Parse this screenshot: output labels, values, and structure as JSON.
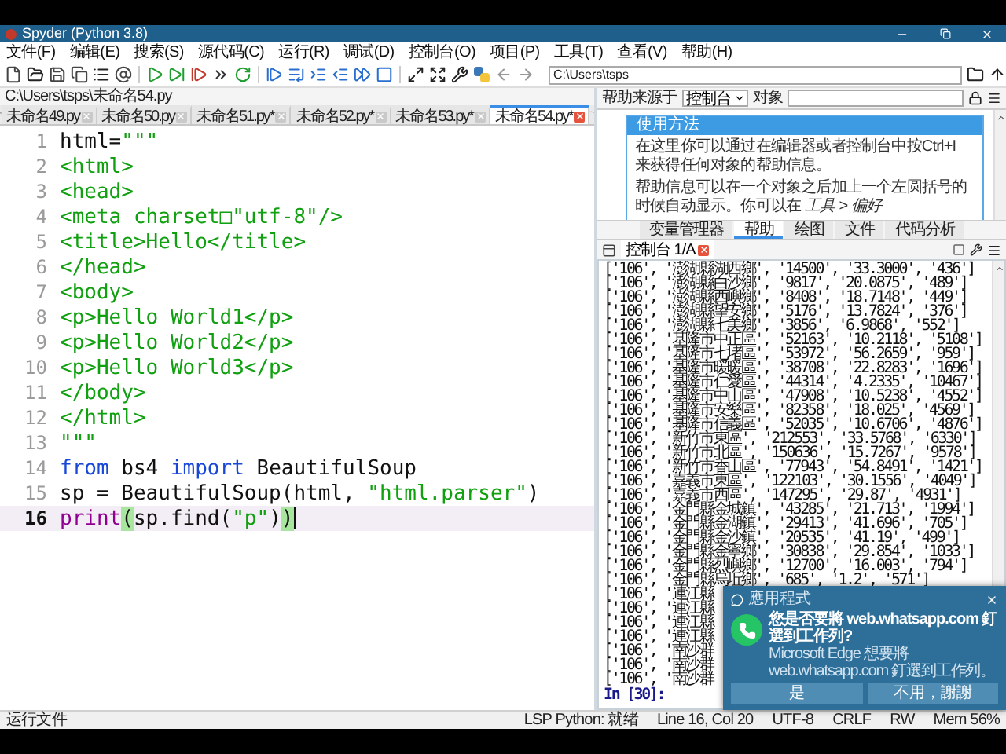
{
  "window": {
    "title": "Spyder (Python 3.8)"
  },
  "menu": [
    "文件(F)",
    "编辑(E)",
    "搜索(S)",
    "源代码(C)",
    "运行(R)",
    "调试(D)",
    "控制台(O)",
    "项目(P)",
    "工具(T)",
    "查看(V)",
    "帮助(H)"
  ],
  "toolbar": {
    "working_directory": "C:\\Users\\tsps"
  },
  "editor": {
    "path": "C:\\Users\\tsps\\未命名54.py",
    "tabs": [
      {
        "label": "未命名49.py",
        "selected": false
      },
      {
        "label": "未命名50.py",
        "selected": false
      },
      {
        "label": "未命名51.py*",
        "selected": false
      },
      {
        "label": "未命名52.py*",
        "selected": false
      },
      {
        "label": "未命名53.py*",
        "selected": false
      },
      {
        "label": "未命名54.py*",
        "selected": true
      }
    ],
    "lines": [
      {
        "number": "1",
        "current": false,
        "tokens": [
          {
            "text": "html=",
            "kind": "plain"
          },
          {
            "text": "\"\"\"",
            "kind": "string"
          }
        ]
      },
      {
        "number": "2",
        "current": false,
        "tokens": [
          {
            "text": "<html>",
            "kind": "string"
          }
        ]
      },
      {
        "number": "3",
        "current": false,
        "tokens": [
          {
            "text": "<head>",
            "kind": "string"
          }
        ]
      },
      {
        "number": "4",
        "current": false,
        "tokens": [
          {
            "text": "<meta charset□\"utf-8\"/>",
            "kind": "string"
          }
        ]
      },
      {
        "number": "5",
        "current": false,
        "tokens": [
          {
            "text": "<title>Hello</title>",
            "kind": "string"
          }
        ]
      },
      {
        "number": "6",
        "current": false,
        "tokens": [
          {
            "text": "</head>",
            "kind": "string"
          }
        ]
      },
      {
        "number": "7",
        "current": false,
        "tokens": [
          {
            "text": "<body>",
            "kind": "string"
          }
        ]
      },
      {
        "number": "8",
        "current": false,
        "tokens": [
          {
            "text": "<p>Hello World1</p>",
            "kind": "string"
          }
        ]
      },
      {
        "number": "9",
        "current": false,
        "tokens": [
          {
            "text": "<p>Hello World2</p>",
            "kind": "string"
          }
        ]
      },
      {
        "number": "10",
        "current": false,
        "tokens": [
          {
            "text": "<p>Hello World3</p>",
            "kind": "string"
          }
        ]
      },
      {
        "number": "11",
        "current": false,
        "tokens": [
          {
            "text": "</body>",
            "kind": "string"
          }
        ]
      },
      {
        "number": "12",
        "current": false,
        "tokens": [
          {
            "text": "</html>",
            "kind": "string"
          }
        ]
      },
      {
        "number": "13",
        "current": false,
        "tokens": [
          {
            "text": "\"\"\"",
            "kind": "string"
          }
        ]
      },
      {
        "number": "14",
        "current": false,
        "tokens": [
          {
            "text": "from",
            "kind": "keyword"
          },
          {
            "text": " bs4 ",
            "kind": "plain"
          },
          {
            "text": "import",
            "kind": "keyword"
          },
          {
            "text": " BeautifulSoup",
            "kind": "plain"
          }
        ]
      },
      {
        "number": "15",
        "current": false,
        "tokens": [
          {
            "text": "sp = BeautifulSoup(html, ",
            "kind": "plain"
          },
          {
            "text": "\"html.parser\"",
            "kind": "string"
          },
          {
            "text": ")",
            "kind": "plain"
          }
        ]
      },
      {
        "number": "16",
        "current": true,
        "tokens": [
          {
            "text": "print",
            "kind": "builtin"
          },
          {
            "text": "(",
            "kind": "match"
          },
          {
            "text": "sp.find(",
            "kind": "plain"
          },
          {
            "text": "\"p\"",
            "kind": "string"
          },
          {
            "text": ")",
            "kind": "plain"
          },
          {
            "text": ")",
            "kind": "match"
          }
        ]
      }
    ]
  },
  "help": {
    "source_label": "帮助来源于",
    "source": "控制台",
    "object_label": "对象",
    "card": {
      "title": "使用方法",
      "paragraphs": [
        "在这里你可以通过在编辑器或者控制台中按Ctrl+I 来获得任何对象的帮助信息。",
        "帮助信息可以在一个对象之后加上一个左圆括号的时候自动显示。你可以在 *工具 > 偏好*"
      ]
    },
    "tabs": [
      {
        "label": "变量管理器",
        "selected": false
      },
      {
        "label": "帮助",
        "selected": true
      },
      {
        "label": "绘图",
        "selected": false
      },
      {
        "label": "文件",
        "selected": false
      },
      {
        "label": "代码分析",
        "selected": false
      }
    ]
  },
  "console": {
    "tab": "控制台 1/A",
    "rows": [
      "['106', '澎湖縣湖西鄉', '14500', '33.3000', '436']",
      "['106', '澎湖縣白沙鄉', '9817', '20.0875', '489']",
      "['106', '澎湖縣西嶼鄉', '8408', '18.7148', '449']",
      "['106', '澎湖縣望安鄉', '5176', '13.7824', '376']",
      "['106', '澎湖縣七美鄉', '3856', '6.9868', '552']",
      "['106', '基隆市中正區', '52163', '10.2118', '5108']",
      "['106', '基隆市七堵區', '53972', '56.2659', '959']",
      "['106', '基隆市暖暖區', '38708', '22.8283', '1696']",
      "['106', '基隆市仁愛區', '44314', '4.2335', '10467']",
      "['106', '基隆市中山區', '47908', '10.5238', '4552']",
      "['106', '基隆市安樂區', '82358', '18.025', '4569']",
      "['106', '基隆市信義區', '52035', '10.6706', '4876']",
      "['106', '新竹市東區', '212553', '33.5768', '6330']",
      "['106', '新竹市北區', '150636', '15.7267', '9578']",
      "['106', '新竹市香山區', '77943', '54.8491', '1421']",
      "['106', '嘉義市東區', '122103', '30.1556', '4049']",
      "['106', '嘉義市西區', '147295', '29.87', '4931']",
      "['106', '金門縣金城鎮', '43285', '21.713', '1994']",
      "['106', '金門縣金湖鎮', '29413', '41.696', '705']",
      "['106', '金門縣金沙鎮', '20535', '41.19', '499']",
      "['106', '金門縣金寧鄉', '30838', '29.854', '1033']",
      "['106', '金門縣烈嶼鄉', '12700', '16.003', '794']",
      "['106', '金門縣烏坵鄉', '685', '1.2', '571']",
      "['106', '連江縣",
      "['106', '連江縣",
      "['106', '連江縣",
      "['106', '連江縣",
      "['106', '南沙群",
      "['106', '南沙群",
      "['106', '南沙群"
    ],
    "prompt": "In [30]:"
  },
  "notification": {
    "app": "應用程式",
    "title": "您是否要將 web.whatsapp.com 釘選到工作列?",
    "body": "Microsoft Edge 想要將 web.whatsapp.com 釘選到工作列。",
    "buttons": [
      "是",
      "不用，謝謝"
    ]
  },
  "status_bar": {
    "message": "运行文件",
    "items": [
      "LSP Python: 就绪",
      "Line 16, Col 20",
      "UTF-8",
      "CRLF",
      "RW",
      "Mem 56%"
    ]
  }
}
